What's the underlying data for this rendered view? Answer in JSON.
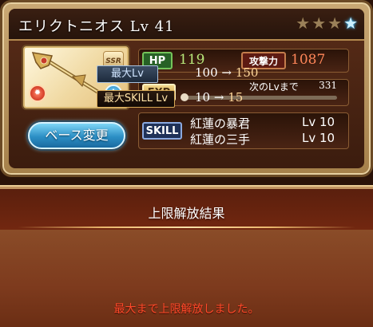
{
  "card": {
    "weapon_name": "エリクトニオス Lv 41",
    "stars": [
      {
        "state": "dim",
        "glyph": "★"
      },
      {
        "state": "dim",
        "glyph": "★"
      },
      {
        "state": "dim",
        "glyph": "★"
      },
      {
        "state": "lit",
        "glyph": "★"
      }
    ],
    "thumbnail": {
      "rarity_badge": "SSR",
      "element_icon": "fire-element-icon",
      "info_icon": "info-icon",
      "info_glyph": "i"
    },
    "base_button_label": "ベース変更",
    "hp": {
      "label": "HP",
      "value": "119"
    },
    "attack": {
      "label": "攻撃力",
      "value": "1087"
    },
    "exp": {
      "label": "EXP",
      "next_label": "次のLvまで",
      "next_value": "331",
      "progress_fraction": 0.0
    },
    "skill": {
      "label": "SKILL",
      "items": [
        {
          "name": "紅蓮の暴君",
          "level": "Lv 10"
        },
        {
          "name": "紅蓮の三手",
          "level": "Lv 10"
        }
      ]
    }
  },
  "result": {
    "title": "上限解放結果",
    "max_lv": {
      "label": "最大Lv",
      "from": "100",
      "arrow": "→",
      "to": "150"
    },
    "max_skill_lv": {
      "label": "最大SKILL Lv",
      "from": "10",
      "arrow": "→",
      "to": "15"
    },
    "message": "最大まで上限解放しました。"
  },
  "colors": {
    "hp_value": "#b8e77a",
    "attack_value": "#ff8659",
    "message": "#ff4a2a",
    "accent_blue": "#2c8fc5"
  }
}
